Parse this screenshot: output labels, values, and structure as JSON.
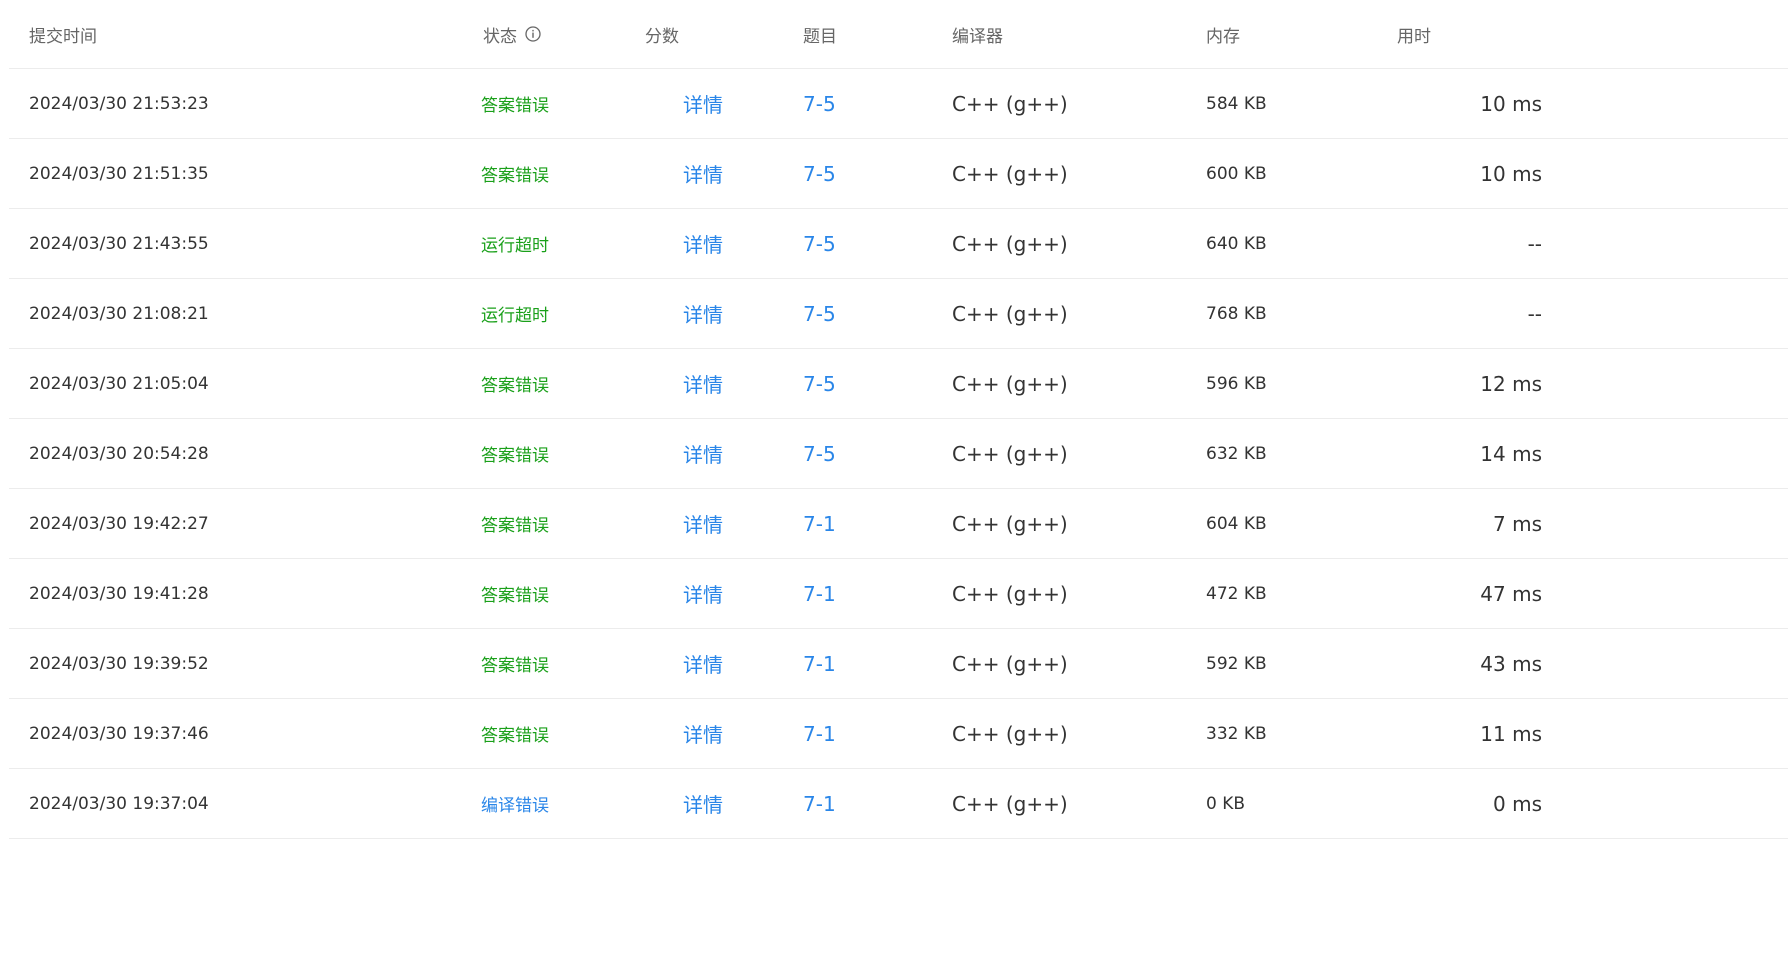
{
  "header": {
    "submit_time": "提交时间",
    "status": "状态",
    "score": "分数",
    "problem": "题目",
    "compiler": "编译器",
    "memory": "内存",
    "time_used": "用时"
  },
  "colors": {
    "status_wrong_answer": "#1aa01a",
    "status_timeout": "#1aa01a",
    "status_compile_error": "#2a86e8",
    "link": "#2a86e8"
  },
  "rows": [
    {
      "time": "2024/03/30 21:53:23",
      "status": "答案错误",
      "status_color": "#1aa01a",
      "score": "详情",
      "problem": "7-5",
      "compiler": "C++ (g++)",
      "memory": "584 KB",
      "time_used": "10 ms"
    },
    {
      "time": "2024/03/30 21:51:35",
      "status": "答案错误",
      "status_color": "#1aa01a",
      "score": "详情",
      "problem": "7-5",
      "compiler": "C++ (g++)",
      "memory": "600 KB",
      "time_used": "10 ms"
    },
    {
      "time": "2024/03/30 21:43:55",
      "status": "运行超时",
      "status_color": "#1aa01a",
      "score": "详情",
      "problem": "7-5",
      "compiler": "C++ (g++)",
      "memory": "640 KB",
      "time_used": "--"
    },
    {
      "time": "2024/03/30 21:08:21",
      "status": "运行超时",
      "status_color": "#1aa01a",
      "score": "详情",
      "problem": "7-5",
      "compiler": "C++ (g++)",
      "memory": "768 KB",
      "time_used": "--"
    },
    {
      "time": "2024/03/30 21:05:04",
      "status": "答案错误",
      "status_color": "#1aa01a",
      "score": "详情",
      "problem": "7-5",
      "compiler": "C++ (g++)",
      "memory": "596 KB",
      "time_used": "12 ms"
    },
    {
      "time": "2024/03/30 20:54:28",
      "status": "答案错误",
      "status_color": "#1aa01a",
      "score": "详情",
      "problem": "7-5",
      "compiler": "C++ (g++)",
      "memory": "632 KB",
      "time_used": "14 ms"
    },
    {
      "time": "2024/03/30 19:42:27",
      "status": "答案错误",
      "status_color": "#1aa01a",
      "score": "详情",
      "problem": "7-1",
      "compiler": "C++ (g++)",
      "memory": "604 KB",
      "time_used": "7 ms"
    },
    {
      "time": "2024/03/30 19:41:28",
      "status": "答案错误",
      "status_color": "#1aa01a",
      "score": "详情",
      "problem": "7-1",
      "compiler": "C++ (g++)",
      "memory": "472 KB",
      "time_used": "47 ms"
    },
    {
      "time": "2024/03/30 19:39:52",
      "status": "答案错误",
      "status_color": "#1aa01a",
      "score": "详情",
      "problem": "7-1",
      "compiler": "C++ (g++)",
      "memory": "592 KB",
      "time_used": "43 ms"
    },
    {
      "time": "2024/03/30 19:37:46",
      "status": "答案错误",
      "status_color": "#1aa01a",
      "score": "详情",
      "problem": "7-1",
      "compiler": "C++ (g++)",
      "memory": "332 KB",
      "time_used": "11 ms"
    },
    {
      "time": "2024/03/30 19:37:04",
      "status": "编译错误",
      "status_color": "#2a86e8",
      "score": "详情",
      "problem": "7-1",
      "compiler": "C++ (g++)",
      "memory": "0 KB",
      "time_used": "0 ms"
    }
  ]
}
